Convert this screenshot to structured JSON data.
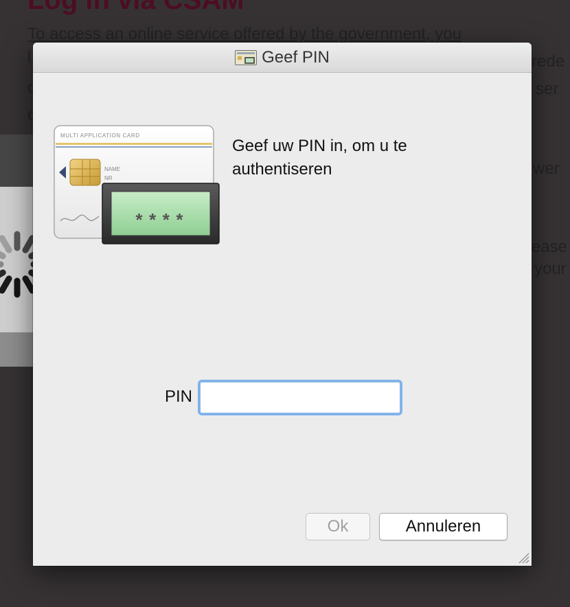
{
  "background": {
    "title": "Log in via CSAM",
    "line1": "To access an online service offered by the government, you",
    "frag_right1": "rede",
    "frag_right2": "e ser",
    "frag_right3": "wer",
    "frag_right4": "ease",
    "frag_right5": "your"
  },
  "dialog": {
    "title": "Geef PIN",
    "message": "Geef uw PIN in, om u te authentiseren",
    "pin_label": "PIN",
    "pin_value": "",
    "ok_label": "Ok",
    "cancel_label": "Annuleren"
  },
  "card": {
    "header": "MULTI APPLICATION CARD",
    "name_label": "NAME",
    "nr_label": "NR",
    "pin_mask": "****"
  }
}
